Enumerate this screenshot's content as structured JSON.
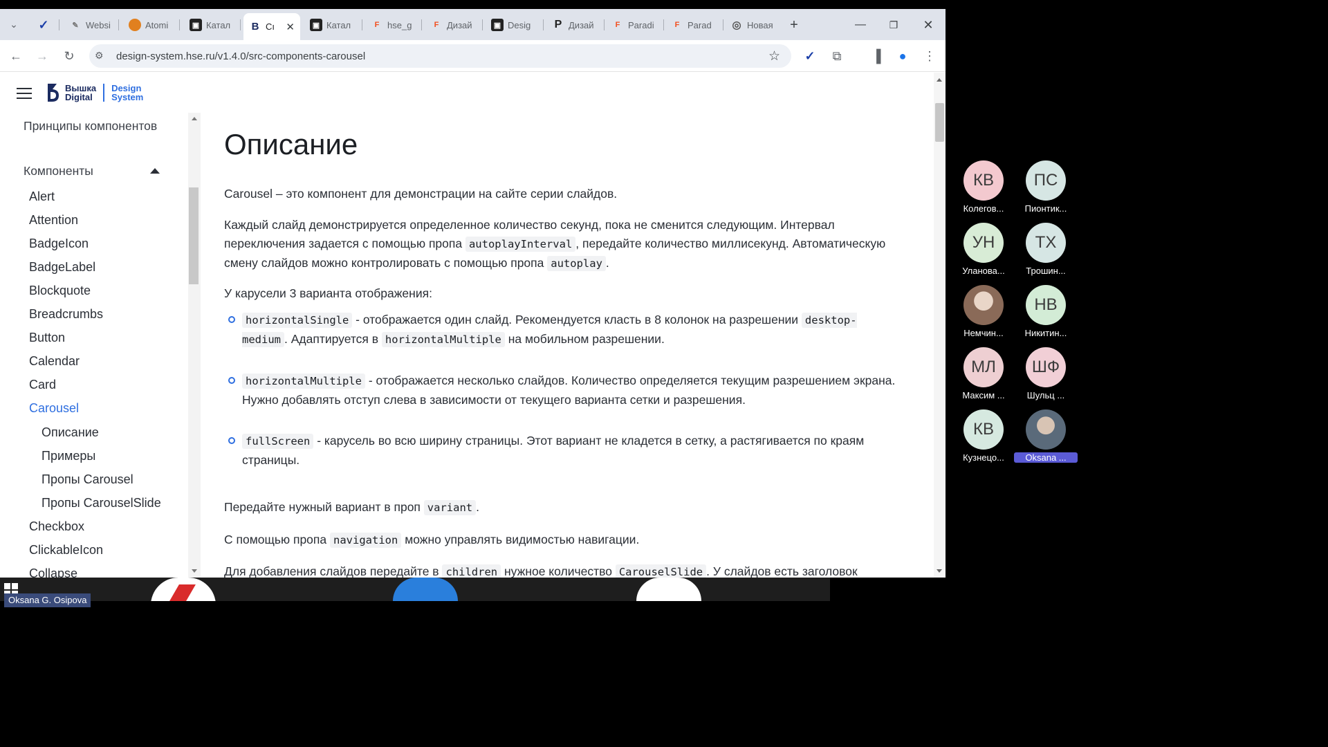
{
  "browser": {
    "tabs": [
      {
        "label": "",
        "icon": "vivaldi-like-icon"
      },
      {
        "label": "Websi",
        "icon": "feather-icon"
      },
      {
        "label": "Atomi",
        "icon": "orange-circle-icon"
      },
      {
        "label": "Катал",
        "icon": "dark-square-icon"
      },
      {
        "label": "Cı",
        "icon": "hse-logo-icon",
        "active": true
      },
      {
        "label": "Катал",
        "icon": "dark-square-icon"
      },
      {
        "label": "hse_g",
        "icon": "figma-icon"
      },
      {
        "label": "Дизай",
        "icon": "figma-icon"
      },
      {
        "label": "Desig",
        "icon": "dark-square-icon"
      },
      {
        "label": "Дизай",
        "icon": "p-letter-icon"
      },
      {
        "label": "Paradi",
        "icon": "figma-icon"
      },
      {
        "label": "Parad",
        "icon": "figma-icon"
      },
      {
        "label": "Новая",
        "icon": "chrome-icon"
      }
    ],
    "new_tab": "+",
    "url": "design-system.hse.ru/v1.4.0/src-components-carousel"
  },
  "site": {
    "logo_line1": "Вышка",
    "logo_line2": "Digital",
    "ds_line1": "Design",
    "ds_line2": "System"
  },
  "sidebar": {
    "section_principles": "Принципы компонентов",
    "section_components": "Компоненты",
    "items": [
      "Alert",
      "Attention",
      "BadgeIcon",
      "BadgeLabel",
      "Blockquote",
      "Breadcrumbs",
      "Button",
      "Calendar",
      "Card",
      "Carousel"
    ],
    "sub_items": [
      "Описание",
      "Примеры",
      "Пропы Carousel",
      "Пропы CarouselSlide"
    ],
    "items_after": [
      "Checkbox",
      "ClickableIcon",
      "Collapse"
    ]
  },
  "content": {
    "title": "Описание",
    "p1": "Carousel – это компонент для демонстрации на сайте серии слайдов.",
    "p2_a": "Каждый слайд демонстрируется определенное количество секунд, пока не сменится следующим. Интервал переключения задается с помощью пропа ",
    "p2_code1": "autoplayInterval",
    "p2_b": ", передайте количество миллисекунд. Автоматическую смену слайдов можно контролировать с помощью пропа ",
    "p2_code2": "autoplay",
    "p2_c": ".",
    "p3": "У карусели 3 варианта отображения:",
    "li1_code": "horizontalSingle",
    "li1_a": " - отображается один слайд. Рекомендуется класть в 8 колонок на разрешении ",
    "li1_code2": "desktop-medium",
    "li1_b": ". Адаптируется в ",
    "li1_code3": "horizontalMultiple",
    "li1_c": " на мобильном разрешении.",
    "li2_code": "horizontalMultiple",
    "li2_a": " - отображается несколько слайдов. Количество определяется текущим разрешением экрана. Нужно добавлять отступ слева в зависимости от текущего варианта сетки и разрешения.",
    "li3_code": "fullScreen",
    "li3_a": " - карусель во всю ширину страницы. Этот вариант не кладется в сетку, а растягивается по краям страницы.",
    "p4_a": "Передайте нужный вариант в проп ",
    "p4_code": "variant",
    "p4_b": ".",
    "p5_a": "С помощью пропа ",
    "p5_code": "navigation",
    "p5_b": " можно управлять видимостью навигации.",
    "p6_a": "Для добавления слайдов передайте в ",
    "p6_code": "children",
    "p6_b": " нужное количество ",
    "p6_code2": "CarouselSlide",
    "p6_c": ". У слайдов есть заголовок"
  },
  "participants": [
    {
      "initials": "КВ",
      "name": "Колегов...",
      "color": "#f3c9cf"
    },
    {
      "initials": "ПС",
      "name": "Пионтик...",
      "color": "#d6e6e4"
    },
    {
      "initials": "УН",
      "name": "Уланова...",
      "color": "#d8ecd6"
    },
    {
      "initials": "ТХ",
      "name": "Трошин...",
      "color": "#d6e6e4"
    },
    {
      "initials": "",
      "name": "Немчин...",
      "color": "#9a7a66"
    },
    {
      "initials": "НВ",
      "name": "Никитин...",
      "color": "#d3ecd6"
    },
    {
      "initials": "МЛ",
      "name": "Максим ...",
      "color": "#eecfd2"
    },
    {
      "initials": "ШФ",
      "name": "Шульц ...",
      "color": "#f1cfd6"
    },
    {
      "initials": "КВ",
      "name": "Кузнецо...",
      "color": "#d6e9e0"
    },
    {
      "initials": "",
      "name": "Oksana ...",
      "color": "#7a8a9a"
    }
  ],
  "presenter_name": "Oksana G. Osipova",
  "colors": {
    "accent": "#2f6fe0",
    "link_active": "#2f6fe0"
  }
}
